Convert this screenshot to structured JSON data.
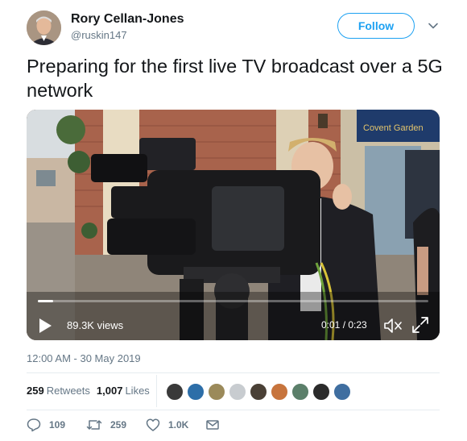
{
  "author": {
    "name": "Rory Cellan-Jones",
    "handle": "@ruskin147",
    "avatar_icon": "profile-photo"
  },
  "follow_label": "Follow",
  "menu_icon": "chevron-down-icon",
  "tweet_text": "Preparing for the first live TV broadcast over a 5G network",
  "video": {
    "views": "89.3K views",
    "time": "0:01 / 0:23",
    "progress": 0.04,
    "sign_text": "Covent Garden",
    "icons": [
      "play-icon",
      "mute-icon",
      "fullscreen-icon"
    ]
  },
  "timestamp": "12:00 AM - 30 May 2019",
  "stats": {
    "retweets_count": "259",
    "retweets_label": "Retweets",
    "likes_count": "1,007",
    "likes_label": "Likes"
  },
  "actions": {
    "replies": "109",
    "retweets": "259",
    "likes": "1.0K"
  },
  "colors": {
    "accent": "#1da1f2",
    "text": "#14171a",
    "muted": "#657786",
    "divider": "#e6ecf0"
  },
  "likers": [
    {
      "name": "liker-1",
      "color": "#3a3a3a"
    },
    {
      "name": "liker-2",
      "color": "#2d6ea8"
    },
    {
      "name": "liker-3",
      "color": "#9b8a5a"
    },
    {
      "name": "liker-4",
      "color": "#c8ccd0"
    },
    {
      "name": "liker-5",
      "color": "#4a4036"
    },
    {
      "name": "liker-6",
      "color": "#c7743d"
    },
    {
      "name": "liker-7",
      "color": "#5b7f6a"
    },
    {
      "name": "liker-8",
      "color": "#2b2b2b"
    },
    {
      "name": "liker-9",
      "color": "#3f6ea0"
    }
  ]
}
